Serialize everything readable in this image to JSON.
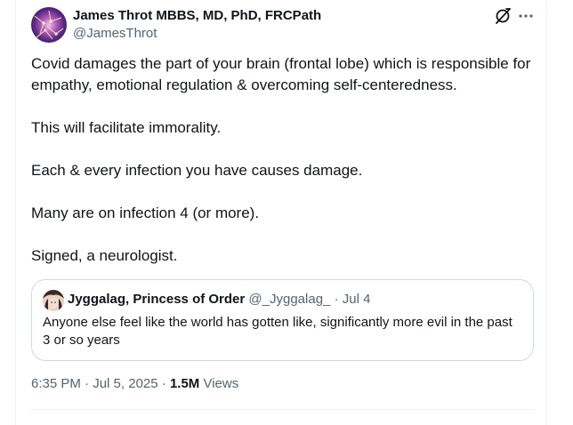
{
  "author": {
    "name": "James Throt MBBS, MD, PhD, FRCPath",
    "handle": "@JamesThrot"
  },
  "tweet": {
    "paragraphs": [
      "Covid damages the part of your brain (frontal lobe) which is responsible for empathy, emotional regulation & overcoming self-centeredness.",
      "This will facilitate immorality.",
      "Each & every infection you have causes damage.",
      "Many are on infection 4 (or more).",
      "Signed, a neurologist."
    ]
  },
  "quote": {
    "name": "Jyggalag, Princess of Order",
    "handle": "@_Jyggalag_",
    "separator": "·",
    "date": "Jul 4",
    "text": "Anyone else feel like the world has gotten like, significantly more evil in the past 3 or so years"
  },
  "meta": {
    "time": "6:35 PM",
    "separator": "·",
    "date": "Jul 5, 2025",
    "views_count": "1.5M",
    "views_label": "Views"
  },
  "icons": {
    "grok": "grok-icon",
    "more": "more-icon"
  },
  "colors": {
    "text_primary": "#0f1419",
    "text_secondary": "#536471",
    "border": "#cfd9de"
  }
}
